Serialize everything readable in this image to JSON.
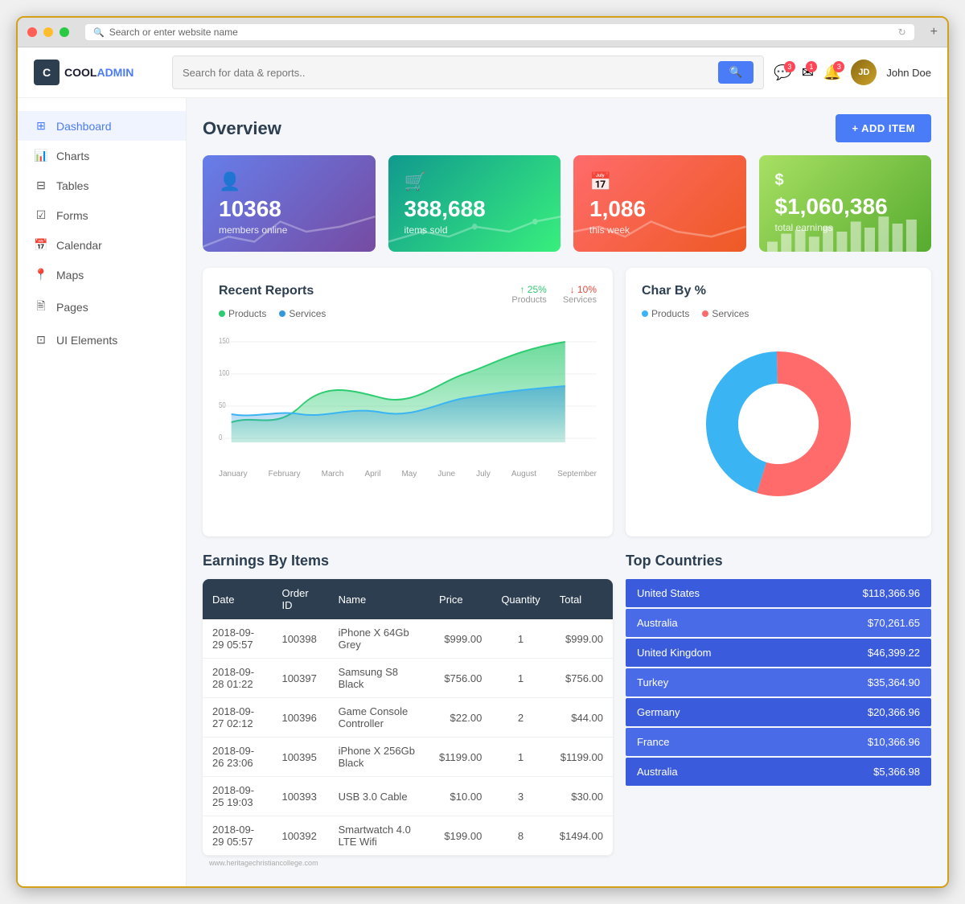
{
  "browser": {
    "url": "Search or enter website name",
    "add_btn": "+"
  },
  "topbar": {
    "logo_c": "C",
    "logo_cool": "COOL",
    "logo_admin": "ADMIN",
    "search_placeholder": "Search for data & reports..",
    "search_btn": "🔍",
    "notifications": [
      {
        "icon": "💬",
        "badge": "3"
      },
      {
        "icon": "✉",
        "badge": "1"
      },
      {
        "icon": "🔔",
        "badge": "3"
      }
    ],
    "user_name": "John Doe"
  },
  "sidebar": {
    "items": [
      {
        "id": "dashboard",
        "label": "Dashboard",
        "icon": "⊞",
        "active": true
      },
      {
        "id": "charts",
        "label": "Charts",
        "icon": "📊",
        "active": false
      },
      {
        "id": "tables",
        "label": "Tables",
        "icon": "⊟",
        "active": false
      },
      {
        "id": "forms",
        "label": "Forms",
        "icon": "☑",
        "active": false
      },
      {
        "id": "calendar",
        "label": "Calendar",
        "icon": "📅",
        "active": false
      },
      {
        "id": "maps",
        "label": "Maps",
        "icon": "📍",
        "active": false
      },
      {
        "id": "pages",
        "label": "Pages",
        "icon": "🖹",
        "active": false
      },
      {
        "id": "ui-elements",
        "label": "UI Elements",
        "icon": "⊡",
        "active": false
      }
    ]
  },
  "overview": {
    "title": "Overview",
    "add_item_btn": "+ ADD ITEM",
    "stats": [
      {
        "icon": "👤",
        "number": "10368",
        "label": "members online",
        "gradient": "1"
      },
      {
        "icon": "🛒",
        "number": "388,688",
        "label": "items sold",
        "gradient": "2"
      },
      {
        "icon": "📅",
        "number": "1,086",
        "label": "this week",
        "gradient": "3"
      },
      {
        "icon": "$",
        "number": "$1,060,386",
        "label": "total earnings",
        "gradient": "4"
      }
    ]
  },
  "recent_reports": {
    "title": "Recent Reports",
    "legend": [
      {
        "label": "Products",
        "color": "#2ecc71"
      },
      {
        "label": "Services",
        "color": "#3498db"
      }
    ],
    "stats": [
      {
        "pct": "↑ 25%",
        "label": "Products",
        "up": true
      },
      {
        "pct": "↓ 10%",
        "label": "Services",
        "up": false
      }
    ],
    "x_labels": [
      "January",
      "February",
      "March",
      "April",
      "May",
      "June",
      "July",
      "August",
      "September"
    ],
    "y_labels": [
      "150",
      "100",
      "50",
      "0"
    ]
  },
  "char_by_pct": {
    "title": "Char By %",
    "legend": [
      {
        "label": "Products",
        "color": "#3ab4f2"
      },
      {
        "label": "Services",
        "color": "#ff6b6b"
      }
    ]
  },
  "earnings": {
    "title": "Earnings By Items",
    "table": {
      "headers": [
        "Date",
        "Order ID",
        "Name",
        "Price",
        "Quantity",
        "Total"
      ],
      "rows": [
        [
          "2018-09-29 05:57",
          "100398",
          "iPhone X 64Gb Grey",
          "$999.00",
          "1",
          "$999.00"
        ],
        [
          "2018-09-28 01:22",
          "100397",
          "Samsung S8 Black",
          "$756.00",
          "1",
          "$756.00"
        ],
        [
          "2018-09-27 02:12",
          "100396",
          "Game Console Controller",
          "$22.00",
          "2",
          "$44.00"
        ],
        [
          "2018-09-26 23:06",
          "100395",
          "iPhone X 256Gb Black",
          "$1199.00",
          "1",
          "$1199.00"
        ],
        [
          "2018-09-25 19:03",
          "100393",
          "USB 3.0 Cable",
          "$10.00",
          "3",
          "$30.00"
        ],
        [
          "2018-09-29 05:57",
          "100392",
          "Smartwatch 4.0 LTE Wifi",
          "$199.00",
          "8",
          "$1494.00"
        ]
      ]
    }
  },
  "top_countries": {
    "title": "Top Countries",
    "items": [
      {
        "name": "United States",
        "value": "$118,366.96"
      },
      {
        "name": "Australia",
        "value": "$70,261.65"
      },
      {
        "name": "United Kingdom",
        "value": "$46,399.22"
      },
      {
        "name": "Turkey",
        "value": "$35,364.90"
      },
      {
        "name": "Germany",
        "value": "$20,366.96"
      },
      {
        "name": "France",
        "value": "$10,366.96"
      },
      {
        "name": "Australia",
        "value": "$5,366.98"
      }
    ]
  },
  "watermark": "www.heritagechristiancollege.com"
}
